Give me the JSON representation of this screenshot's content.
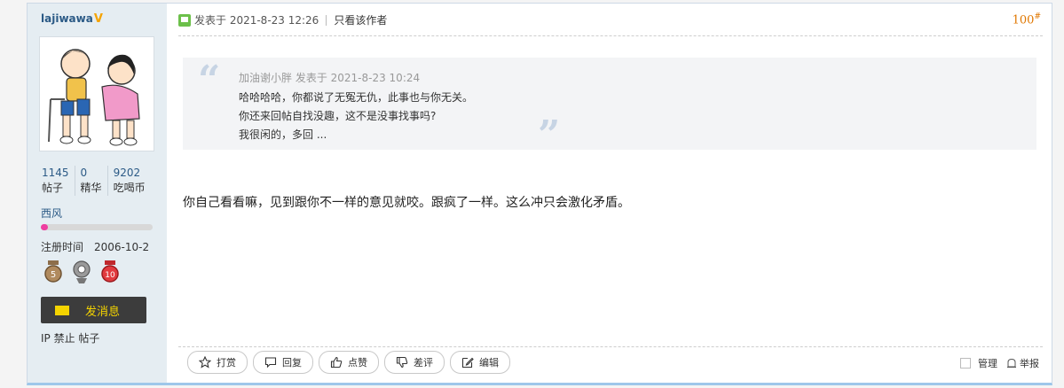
{
  "user": {
    "name": "lajiwawa",
    "badge": "V"
  },
  "stats": [
    {
      "num": "1145",
      "label": "帖子"
    },
    {
      "num": "0",
      "label": "精华"
    },
    {
      "num": "9202",
      "label": "吃喝币"
    }
  ],
  "user_group": "西风",
  "level_progress": 0.06,
  "reg_date": "注册时间　2006-10-2",
  "medals": [
    "medal-5-icon",
    "medal-webcam-icon",
    "medal-10-icon"
  ],
  "message_button": "发消息",
  "ip_line": "IP 禁止 帖子",
  "post": {
    "posted": "发表于 2021-8-23 12:26",
    "only_author": "只看该作者",
    "floor": "100",
    "floor_sup": "#"
  },
  "quote": {
    "meta": "加油谢小胖 发表于 2021-8-23 10:24",
    "lines": [
      "哈哈哈哈，你都说了无冤无仇，此事也与你无关。",
      "你还来回帖自找没趣，这不是没事找事吗?",
      "我很闲的，多回 ..."
    ]
  },
  "content": "你自己看看嘛，见到跟你不一样的意见就咬。跟疯了一样。这么冲只会激化矛盾。",
  "actions": [
    "打赏",
    "回复",
    "点赞",
    "差评",
    "编辑"
  ],
  "manage": {
    "label": "管理",
    "report": "举报"
  },
  "colors": {
    "accent": "#2b5a86",
    "floor": "#e07700",
    "level": "#ee3ea0",
    "msg_text": "#f5d400"
  }
}
